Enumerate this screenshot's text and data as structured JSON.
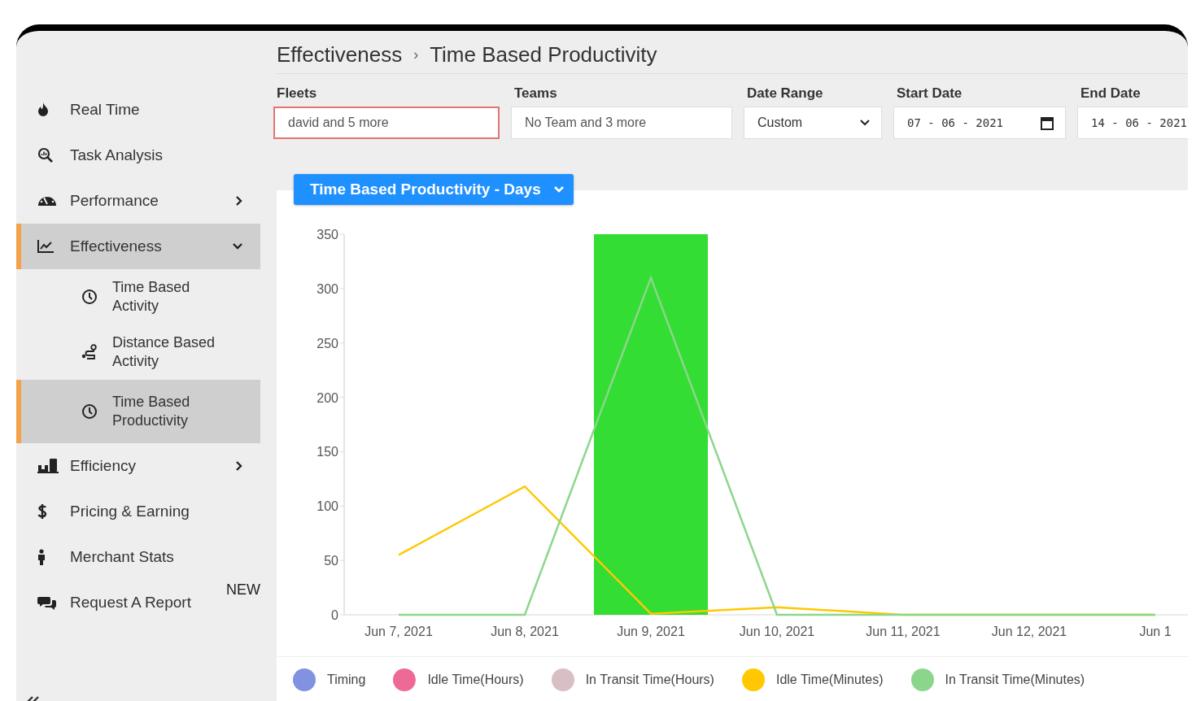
{
  "sidebar": {
    "items": [
      {
        "label": "Real Time",
        "selected": false
      },
      {
        "label": "Task Analysis",
        "selected": false
      },
      {
        "label": "Performance",
        "selected": false,
        "expanded": false
      },
      {
        "label": "Effectiveness",
        "selected": true,
        "expanded": true,
        "children": [
          {
            "label": "Time Based Activity",
            "selected": false
          },
          {
            "label": "Distance Based Activity",
            "selected": false
          },
          {
            "label": "Time Based Productivity",
            "selected": true
          }
        ]
      },
      {
        "label": "Efficiency",
        "selected": false,
        "expanded": false
      },
      {
        "label": "Pricing & Earning",
        "selected": false
      },
      {
        "label": "Merchant Stats",
        "selected": false
      },
      {
        "label": "Request A Report",
        "selected": false,
        "badge": "NEW"
      }
    ]
  },
  "breadcrumb": [
    "Effectiveness",
    "›",
    "Time Based Productivity"
  ],
  "filters": [
    {
      "label": "Fleets",
      "kind": "text",
      "value": "david and 5 more",
      "highlighted": true
    },
    {
      "label": "Teams",
      "kind": "text",
      "value": "No Team and 3 more",
      "highlighted": false
    },
    {
      "label": "Date Range",
      "kind": "select",
      "value": "Custom",
      "highlighted": false
    },
    {
      "label": "Start Date",
      "kind": "date",
      "value": "07 - 06 - 2021",
      "highlighted": false
    },
    {
      "label": "End Date",
      "kind": "date",
      "value": "14 - 06 - 2021",
      "highlighted": false
    }
  ],
  "report_menu": {
    "label": "Time Based Productivity - Days"
  },
  "chart": {
    "chart_data": {
      "type": "line",
      "bands": [
        {
          "axis": "x",
          "from": "Jun 9, 2021",
          "to": "Jun 9, 2021",
          "color": "#33dd33"
        }
      ],
      "categories": [
        "Jun 7, 2021",
        "Jun 8, 2021",
        "Jun 9, 2021",
        "Jun 10, 2021",
        "Jun 11, 2021",
        "Jun 12, 2021",
        "Jun 1"
      ],
      "ylim": [
        0,
        350
      ],
      "yticks": [
        0,
        50,
        100,
        150,
        200,
        250,
        300,
        350
      ],
      "series": [
        {
          "name": "Timing",
          "color": "#8092e0",
          "values": [
            null,
            null,
            null,
            null,
            null,
            null,
            null
          ]
        },
        {
          "name": "Idle Time(Hours)",
          "color": "#ee6a96",
          "values": [
            null,
            null,
            null,
            null,
            null,
            null,
            null
          ]
        },
        {
          "name": "In Transit Time(Hours)",
          "color": "#d8bfc4",
          "values": [
            null,
            null,
            null,
            null,
            null,
            null,
            null
          ]
        },
        {
          "name": "Idle Time(Minutes)",
          "color": "#ffc800",
          "values": [
            55,
            118,
            1,
            7,
            0,
            0,
            0
          ]
        },
        {
          "name": "In Transit Time(Minutes)",
          "color": "#8cd68c",
          "values": [
            0,
            0,
            310,
            0,
            0,
            0,
            0
          ]
        }
      ]
    }
  }
}
